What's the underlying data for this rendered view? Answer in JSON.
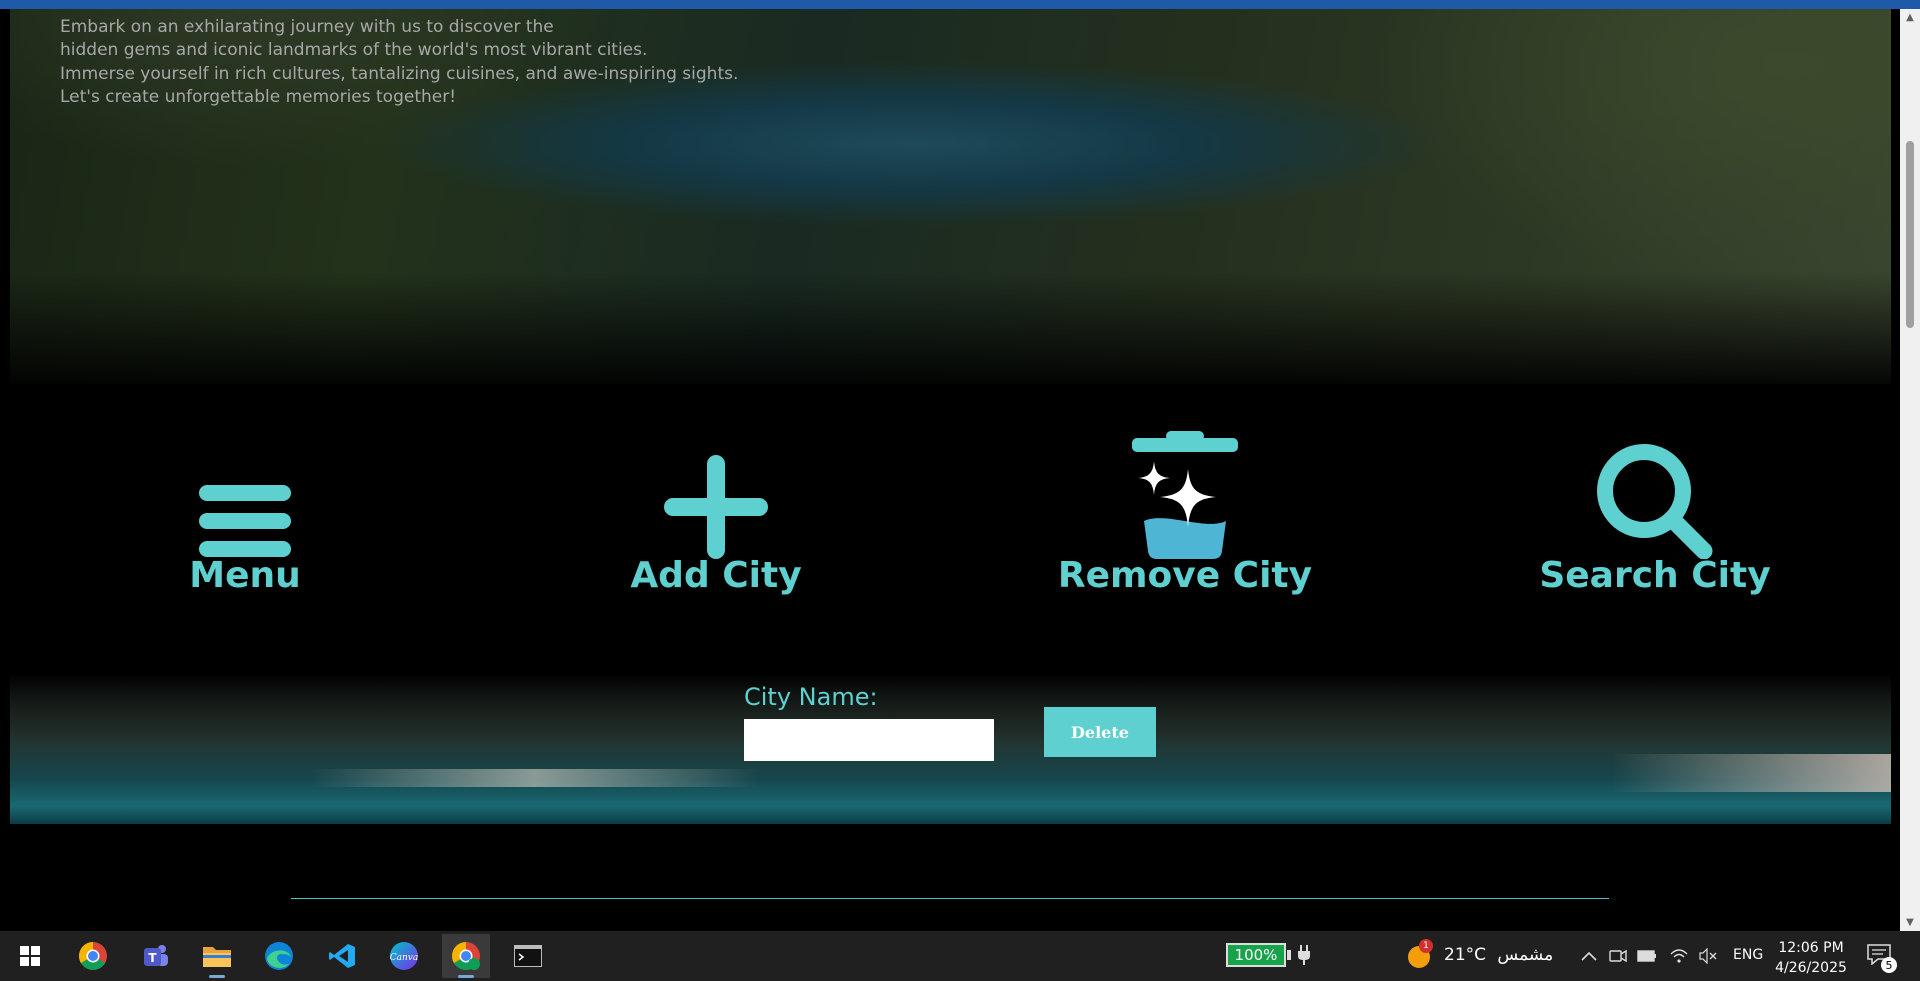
{
  "intro": {
    "line1": "Embark on an exhilarating journey with us to discover the",
    "line2": "hidden gems and iconic landmarks of the world's most vibrant cities.",
    "line3": "Immerse yourself in rich cultures, tantalizing cuisines, and awe-inspiring sights.",
    "line4": "Let's create unforgettable memories together!"
  },
  "features": [
    {
      "label": "Menu",
      "icon": "menu-icon"
    },
    {
      "label": "Add City",
      "icon": "plus-icon"
    },
    {
      "label": "Remove City",
      "icon": "clean-trash-icon"
    },
    {
      "label": "Search City",
      "icon": "search-icon"
    }
  ],
  "form": {
    "label": "City Name:",
    "input_value": "",
    "input_placeholder": "",
    "delete_label": "Delete"
  },
  "colors": {
    "accent": "#5fd0d0",
    "top_bar": "#1e5aa8",
    "battery": "#16a34a",
    "divider": "#4ac0c8"
  },
  "taskbar": {
    "apps": [
      "windows-start-icon",
      "chrome-icon",
      "teams-icon",
      "file-explorer-icon",
      "edge-icon",
      "vscode-icon",
      "canva-icon",
      "chrome-profile-icon",
      "terminal-icon"
    ],
    "battery": "100%",
    "weather_badge": "1",
    "temperature": "21°C",
    "weather_text": "مشمس",
    "language": "ENG",
    "time": "12:06 PM",
    "date": "4/26/2025",
    "notifications": "5"
  }
}
